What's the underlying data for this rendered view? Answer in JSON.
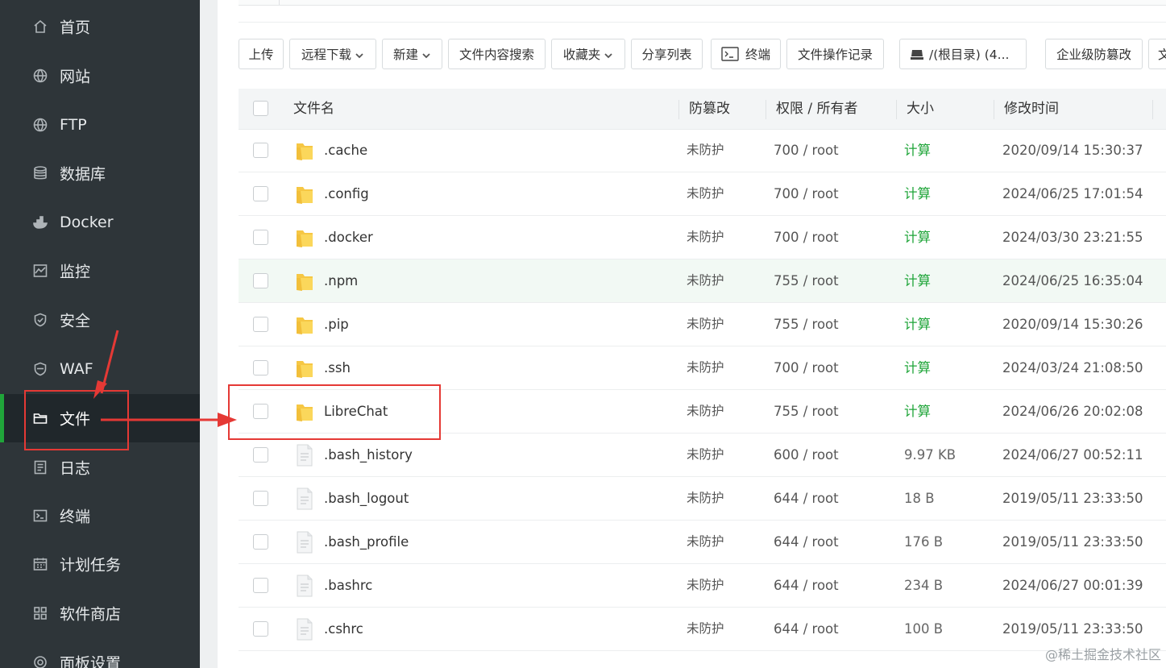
{
  "sidebar": {
    "items": [
      {
        "label": "首页",
        "icon": "home-icon"
      },
      {
        "label": "网站",
        "icon": "globe-icon"
      },
      {
        "label": "FTP",
        "icon": "globe-icon"
      },
      {
        "label": "数据库",
        "icon": "database-icon"
      },
      {
        "label": "Docker",
        "icon": "docker-icon"
      },
      {
        "label": "监控",
        "icon": "monitor-icon"
      },
      {
        "label": "安全",
        "icon": "shield-icon"
      },
      {
        "label": "WAF",
        "icon": "waf-shield-icon"
      },
      {
        "label": "文件",
        "icon": "folder-icon",
        "active": true
      },
      {
        "label": "日志",
        "icon": "log-icon"
      },
      {
        "label": "终端",
        "icon": "terminal-icon"
      },
      {
        "label": "计划任务",
        "icon": "calendar-icon"
      },
      {
        "label": "软件商店",
        "icon": "grid-icon"
      },
      {
        "label": "面板设置",
        "icon": "gear-icon"
      }
    ]
  },
  "toolbar": {
    "upload": "上传",
    "remote_download": "远程下载",
    "new": "新建",
    "content_search": "文件内容搜索",
    "favorites": "收藏夹",
    "share_list": "分享列表",
    "terminal": "终端",
    "operation_log": "文件操作记录",
    "path": "/(根目录) (4...",
    "tamper_proof": "企业级防篡改",
    "cut_off": "文"
  },
  "table": {
    "headers": {
      "name": "文件名",
      "protect": "防篡改",
      "perm": "权限 / 所有者",
      "size": "大小",
      "mtime": "修改时间"
    },
    "rows": [
      {
        "name": ".cache",
        "type": "folder",
        "protect": "未防护",
        "perm": "700 / root",
        "size": "计算",
        "mtime": "2020/09/14 15:30:37"
      },
      {
        "name": ".config",
        "type": "folder",
        "protect": "未防护",
        "perm": "700 / root",
        "size": "计算",
        "mtime": "2024/06/25 17:01:54"
      },
      {
        "name": ".docker",
        "type": "folder",
        "protect": "未防护",
        "perm": "700 / root",
        "size": "计算",
        "mtime": "2024/03/30 23:21:55"
      },
      {
        "name": ".npm",
        "type": "folder",
        "protect": "未防护",
        "perm": "755 / root",
        "size": "计算",
        "mtime": "2024/06/25 16:35:04"
      },
      {
        "name": ".pip",
        "type": "folder",
        "protect": "未防护",
        "perm": "755 / root",
        "size": "计算",
        "mtime": "2020/09/14 15:30:26"
      },
      {
        "name": ".ssh",
        "type": "folder",
        "protect": "未防护",
        "perm": "700 / root",
        "size": "计算",
        "mtime": "2024/03/24 21:08:50"
      },
      {
        "name": "LibreChat",
        "type": "folder",
        "protect": "未防护",
        "perm": "755 / root",
        "size": "计算",
        "mtime": "2024/06/26 20:02:08"
      },
      {
        "name": ".bash_history",
        "type": "file",
        "protect": "未防护",
        "perm": "600 / root",
        "size": "9.97 KB",
        "mtime": "2024/06/27 00:52:11"
      },
      {
        "name": ".bash_logout",
        "type": "file",
        "protect": "未防护",
        "perm": "644 / root",
        "size": "18 B",
        "mtime": "2019/05/11 23:33:50"
      },
      {
        "name": ".bash_profile",
        "type": "file",
        "protect": "未防护",
        "perm": "644 / root",
        "size": "176 B",
        "mtime": "2019/05/11 23:33:50"
      },
      {
        "name": ".bashrc",
        "type": "file",
        "protect": "未防护",
        "perm": "644 / root",
        "size": "234 B",
        "mtime": "2024/06/27 00:01:39"
      },
      {
        "name": ".cshrc",
        "type": "file",
        "protect": "未防护",
        "perm": "644 / root",
        "size": "100 B",
        "mtime": "2019/05/11 23:33:50"
      }
    ]
  },
  "watermark": "@稀土掘金技术社区",
  "colors": {
    "accent": "#20a53a",
    "sidebar_bg": "#2e3539",
    "annotation": "#e53935"
  }
}
